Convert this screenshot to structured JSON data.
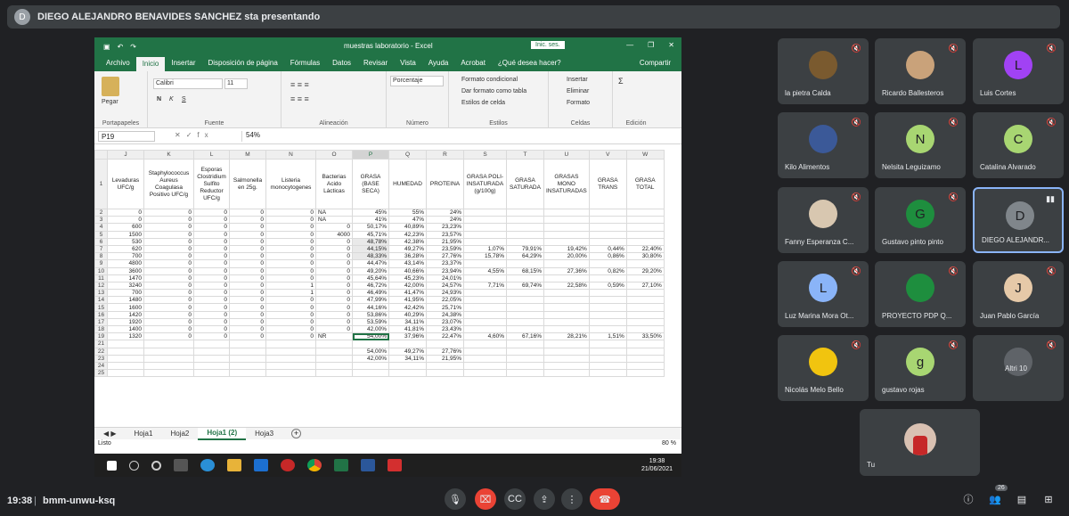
{
  "topbar": {
    "avatar": "D",
    "presenting": "DIEGO ALEJANDRO BENAVIDES SANCHEZ sta presentando"
  },
  "excel": {
    "doc_title": "muestras laboratorio  -  Excel",
    "login": "Inic. ses.",
    "menu": [
      "Archivo",
      "Inicio",
      "Insertar",
      "Disposición de página",
      "Fórmulas",
      "Datos",
      "Revisar",
      "Vista",
      "Ayuda",
      "Acrobat",
      "¿Qué desea hacer?"
    ],
    "share": "Compartir",
    "ribbon": {
      "paste": "Pegar",
      "clipboard": "Portapapeles",
      "font_name": "Calibri",
      "font_size": "11",
      "font": "Fuente",
      "bold": "N",
      "italic": "K",
      "underline": "S",
      "alignment": "Alineación",
      "number_format": "Porcentaje",
      "number": "Número",
      "cond_format": "Formato condicional",
      "table_format": "Dar formato como tabla",
      "cell_styles": "Estilos de celda",
      "styles": "Estilos",
      "insert": "Insertar",
      "delete": "Eliminar",
      "format": "Formato",
      "cells": "Celdas",
      "editing": "Edición"
    },
    "namebox": "P19",
    "formula": "54%",
    "columns": [
      "",
      "J",
      "K",
      "L",
      "M",
      "N",
      "O",
      "P",
      "Q",
      "R",
      "S",
      "T",
      "U",
      "V",
      "W"
    ],
    "headers": [
      "1",
      "Levaduras UFC/g",
      "Staphylococcus Aureus Coagulasa Positivo UFC/g",
      "Esporas Clostridium Sulfito Reductor UFC/g",
      "Salmonella en 25g.",
      "Listeria monocytogenes",
      "Bacterias Acido Lácticas",
      "GRASA (BASE SECA)",
      "HUMEDAD",
      "PROTEINA",
      "GRASA POLI-INSATURADA (g/100g)",
      "GRASA SATURADA",
      "GRASAS MONO INSATURADAS",
      "GRASA TRANS",
      "GRASA TOTAL"
    ],
    "rows": [
      [
        "2",
        "0",
        "0",
        "0",
        "0",
        "0",
        "NA",
        "45%",
        "55%",
        "24%",
        "",
        "",
        "",
        "",
        ""
      ],
      [
        "3",
        "0",
        "0",
        "0",
        "0",
        "0",
        "NA",
        "41%",
        "47%",
        "24%",
        "",
        "",
        "",
        "",
        ""
      ],
      [
        "4",
        "600",
        "0",
        "0",
        "0",
        "0",
        "0",
        "50,17%",
        "40,89%",
        "23,23%",
        "",
        "",
        "",
        "",
        ""
      ],
      [
        "5",
        "1500",
        "0",
        "0",
        "0",
        "0",
        "4000",
        "45,71%",
        "42,23%",
        "23,57%",
        "",
        "",
        "",
        "",
        ""
      ],
      [
        "6",
        "530",
        "0",
        "0",
        "0",
        "0",
        "0",
        "48,78%",
        "42,38%",
        "21,95%",
        "",
        "",
        "",
        "",
        ""
      ],
      [
        "7",
        "620",
        "0",
        "0",
        "0",
        "0",
        "0",
        "44,15%",
        "49,27%",
        "23,59%",
        "1,07%",
        "79,91%",
        "19,42%",
        "0,44%",
        "22,40%"
      ],
      [
        "8",
        "700",
        "0",
        "0",
        "0",
        "0",
        "0",
        "48,33%",
        "36,28%",
        "27,76%",
        "15,78%",
        "64,29%",
        "20,00%",
        "0,86%",
        "30,80%"
      ],
      [
        "9",
        "4800",
        "0",
        "0",
        "0",
        "0",
        "0",
        "44,47%",
        "43,14%",
        "23,37%",
        "",
        "",
        "",
        "",
        ""
      ],
      [
        "10",
        "3600",
        "0",
        "0",
        "0",
        "0",
        "0",
        "49,20%",
        "40,66%",
        "23,94%",
        "4,55%",
        "68,15%",
        "27,36%",
        "0,82%",
        "29,20%"
      ],
      [
        "11",
        "1470",
        "0",
        "0",
        "0",
        "0",
        "0",
        "45,64%",
        "45,23%",
        "24,01%",
        "",
        "",
        "",
        "",
        ""
      ],
      [
        "12",
        "3240",
        "0",
        "0",
        "0",
        "1",
        "0",
        "46,72%",
        "42,00%",
        "24,57%",
        "7,71%",
        "69,74%",
        "22,58%",
        "0,59%",
        "27,10%"
      ],
      [
        "13",
        "700",
        "0",
        "0",
        "0",
        "1",
        "0",
        "46,49%",
        "41,47%",
        "24,93%",
        "",
        "",
        "",
        "",
        ""
      ],
      [
        "14",
        "1480",
        "0",
        "0",
        "0",
        "0",
        "0",
        "47,99%",
        "41,95%",
        "22,05%",
        "",
        "",
        "",
        "",
        ""
      ],
      [
        "15",
        "1600",
        "0",
        "0",
        "0",
        "0",
        "0",
        "44,16%",
        "42,42%",
        "25,71%",
        "",
        "",
        "",
        "",
        ""
      ],
      [
        "16",
        "1420",
        "0",
        "0",
        "0",
        "0",
        "0",
        "53,86%",
        "40,29%",
        "24,38%",
        "",
        "",
        "",
        "",
        ""
      ],
      [
        "17",
        "1920",
        "0",
        "0",
        "0",
        "0",
        "0",
        "53,59%",
        "34,11%",
        "23,07%",
        "",
        "",
        "",
        "",
        ""
      ],
      [
        "18",
        "1400",
        "0",
        "0",
        "0",
        "0",
        "0",
        "42,00%",
        "41,81%",
        "23,43%",
        "",
        "",
        "",
        "",
        ""
      ],
      [
        "19",
        "1320",
        "0",
        "0",
        "0",
        "0",
        "NR",
        "54,00%",
        "37,96%",
        "22,47%",
        "4,60%",
        "67,16%",
        "28,21%",
        "1,51%",
        "33,50%"
      ],
      [
        "21",
        "",
        "",
        "",
        "",
        "",
        "",
        "",
        "",
        "",
        "",
        "",
        "",
        "",
        ""
      ],
      [
        "22",
        "",
        "",
        "",
        "",
        "",
        "",
        "54,00%",
        "49,27%",
        "27,76%",
        "",
        "",
        "",
        "",
        ""
      ],
      [
        "23",
        "",
        "",
        "",
        "",
        "",
        "",
        "42,00%",
        "34,11%",
        "21,95%",
        "",
        "",
        "",
        "",
        ""
      ],
      [
        "24",
        "",
        "",
        "",
        "",
        "",
        "",
        "",
        "",
        "",
        "",
        "",
        "",
        "",
        ""
      ],
      [
        "25",
        "",
        "",
        "",
        "",
        "",
        "",
        "",
        "",
        "",
        "",
        "",
        "",
        "",
        ""
      ]
    ],
    "sheets": [
      "Hoja1",
      "Hoja2",
      "Hoja1 (2)",
      "Hoja3"
    ],
    "status": "Listo",
    "zoom": "80 %",
    "clock_time": "19:38",
    "clock_date": "21/06/2021"
  },
  "participants": [
    {
      "name": "la pietra Calda",
      "avatar": "",
      "color": "#7a5a2f"
    },
    {
      "name": "Ricardo Ballesteros",
      "avatar": "",
      "color": "#c9a27a"
    },
    {
      "name": "Luis Cortes",
      "avatar": "L",
      "color": "#a142f4"
    },
    {
      "name": "Kilo Alimentos",
      "avatar": "",
      "color": "#3b5998"
    },
    {
      "name": "Nelsita Leguizamo",
      "avatar": "N",
      "color": "#a8d672"
    },
    {
      "name": "Catalina Alvarado",
      "avatar": "C",
      "color": "#a8d672"
    },
    {
      "name": "Fanny Esperanza C...",
      "avatar": "",
      "color": "#d8c7b0"
    },
    {
      "name": "Gustavo pinto pinto",
      "avatar": "G",
      "color": "#1e8e3e"
    },
    {
      "name": "DIEGO ALEJANDR...",
      "avatar": "D",
      "color": "#80868b"
    },
    {
      "name": "Luz Marina Mora Ot...",
      "avatar": "L",
      "color": "#8ab4f8"
    },
    {
      "name": "PROYECTO PDP Q...",
      "avatar": "",
      "color": "#1e8e3e"
    },
    {
      "name": "Juan Pablo García",
      "avatar": "J",
      "color": "#e6c9a8"
    },
    {
      "name": "Nicolás Melo Bello",
      "avatar": "",
      "color": "#f1c40f"
    },
    {
      "name": "gustavo rojas",
      "avatar": "g",
      "color": "#a8d672"
    },
    {
      "name": "Altri 10",
      "avatar": "",
      "color": "#5f6368"
    }
  ],
  "self": {
    "name": "Tu"
  },
  "meeting": {
    "time": "19:38",
    "separator": "|",
    "code": "bmm-unwu-ksq",
    "people_count": "26"
  }
}
